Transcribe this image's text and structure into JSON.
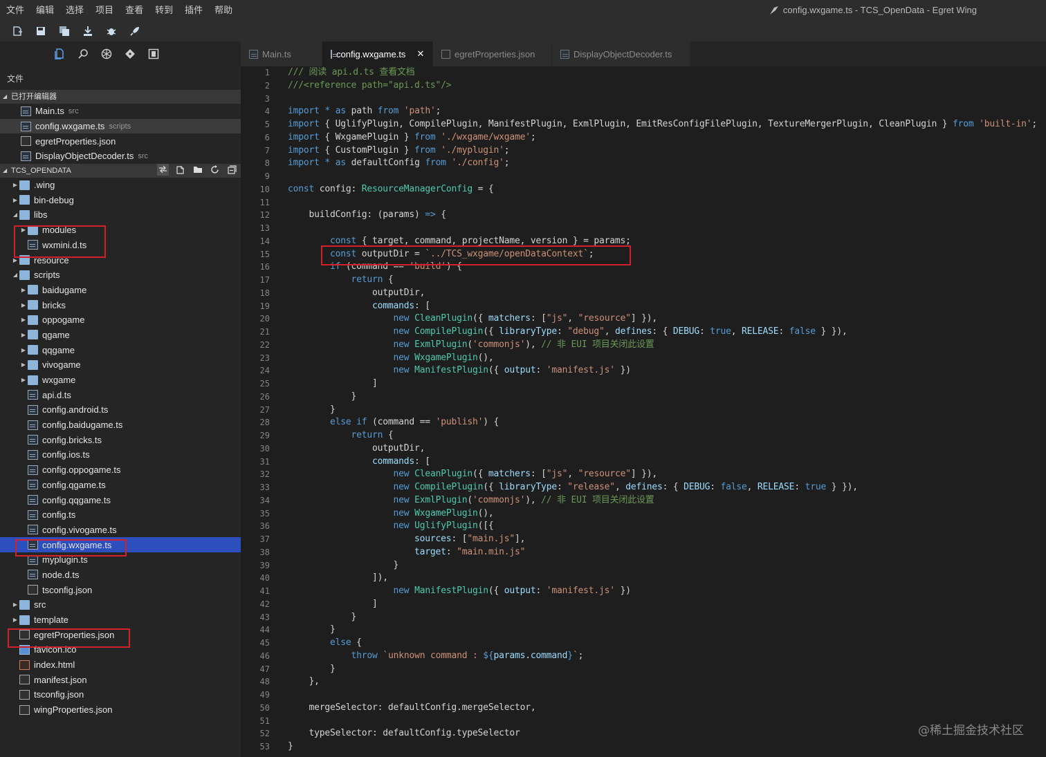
{
  "menu": [
    "文件",
    "编辑",
    "选择",
    "项目",
    "查看",
    "转到",
    "插件",
    "帮助"
  ],
  "window_title": "config.wxgame.ts - TCS_OpenData - Egret Wing",
  "sidebar": {
    "title": "文件",
    "open_editors_label": "已打开编辑器",
    "open_editors": [
      {
        "name": "Main.ts",
        "hint": "src"
      },
      {
        "name": "config.wxgame.ts",
        "hint": "scripts"
      },
      {
        "name": "egretProperties.json",
        "hint": ""
      },
      {
        "name": "DisplayObjectDecoder.ts",
        "hint": "src"
      }
    ],
    "project_label": "TCS_OPENDATA",
    "tree": [
      {
        "name": ".wing",
        "kind": "folder",
        "depth": 0,
        "open": false
      },
      {
        "name": "bin-debug",
        "kind": "folder",
        "depth": 0,
        "open": false
      },
      {
        "name": "libs",
        "kind": "folder",
        "depth": 0,
        "open": true
      },
      {
        "name": "modules",
        "kind": "folder",
        "depth": 1,
        "open": false
      },
      {
        "name": "wxmini.d.ts",
        "kind": "ts",
        "depth": 1
      },
      {
        "name": "resource",
        "kind": "folder",
        "depth": 0,
        "open": false
      },
      {
        "name": "scripts",
        "kind": "folder",
        "depth": 0,
        "open": true
      },
      {
        "name": "baidugame",
        "kind": "folder",
        "depth": 1,
        "open": false
      },
      {
        "name": "bricks",
        "kind": "folder",
        "depth": 1,
        "open": false
      },
      {
        "name": "oppogame",
        "kind": "folder",
        "depth": 1,
        "open": false
      },
      {
        "name": "qgame",
        "kind": "folder",
        "depth": 1,
        "open": false
      },
      {
        "name": "qqgame",
        "kind": "folder",
        "depth": 1,
        "open": false
      },
      {
        "name": "vivogame",
        "kind": "folder",
        "depth": 1,
        "open": false
      },
      {
        "name": "wxgame",
        "kind": "folder",
        "depth": 1,
        "open": false
      },
      {
        "name": "api.d.ts",
        "kind": "ts",
        "depth": 1
      },
      {
        "name": "config.android.ts",
        "kind": "ts",
        "depth": 1
      },
      {
        "name": "config.baidugame.ts",
        "kind": "ts",
        "depth": 1
      },
      {
        "name": "config.bricks.ts",
        "kind": "ts",
        "depth": 1
      },
      {
        "name": "config.ios.ts",
        "kind": "ts",
        "depth": 1
      },
      {
        "name": "config.oppogame.ts",
        "kind": "ts",
        "depth": 1
      },
      {
        "name": "config.qgame.ts",
        "kind": "ts",
        "depth": 1
      },
      {
        "name": "config.qqgame.ts",
        "kind": "ts",
        "depth": 1
      },
      {
        "name": "config.ts",
        "kind": "ts",
        "depth": 1
      },
      {
        "name": "config.vivogame.ts",
        "kind": "ts",
        "depth": 1
      },
      {
        "name": "config.wxgame.ts",
        "kind": "ts",
        "depth": 1,
        "selected": true
      },
      {
        "name": "myplugin.ts",
        "kind": "ts",
        "depth": 1
      },
      {
        "name": "node.d.ts",
        "kind": "ts",
        "depth": 1
      },
      {
        "name": "tsconfig.json",
        "kind": "json",
        "depth": 1
      },
      {
        "name": "src",
        "kind": "folder",
        "depth": 0,
        "open": false
      },
      {
        "name": "template",
        "kind": "folder",
        "depth": 0,
        "open": false
      },
      {
        "name": "egretProperties.json",
        "kind": "json",
        "depth": 0
      },
      {
        "name": "favicon.ico",
        "kind": "ico",
        "depth": 0
      },
      {
        "name": "index.html",
        "kind": "html",
        "depth": 0
      },
      {
        "name": "manifest.json",
        "kind": "json",
        "depth": 0
      },
      {
        "name": "tsconfig.json",
        "kind": "json",
        "depth": 0
      },
      {
        "name": "wingProperties.json",
        "kind": "json",
        "depth": 0
      }
    ]
  },
  "tabs": [
    {
      "label": "Main.ts",
      "active": false,
      "kind": "ts"
    },
    {
      "label": "config.wxgame.ts",
      "active": true,
      "kind": "ts"
    },
    {
      "label": "egretProperties.json",
      "active": false,
      "kind": "json"
    },
    {
      "label": "DisplayObjectDecoder.ts",
      "active": false,
      "kind": "ts"
    }
  ],
  "code_lines": [
    [
      [
        "c",
        "/// 阅读 api.d.ts 查看文档"
      ]
    ],
    [
      [
        "c",
        "///<reference path=\"api.d.ts\"/>"
      ]
    ],
    [],
    [
      [
        "k",
        "import"
      ],
      [
        "n",
        " "
      ],
      [
        "k",
        "*"
      ],
      [
        "n",
        " "
      ],
      [
        "k",
        "as"
      ],
      [
        "n",
        " path "
      ],
      [
        "k",
        "from"
      ],
      [
        "n",
        " "
      ],
      [
        "s",
        "'path'"
      ],
      [
        "n",
        ";"
      ]
    ],
    [
      [
        "k",
        "import"
      ],
      [
        "n",
        " { UglifyPlugin, CompilePlugin, ManifestPlugin, ExmlPlugin, EmitResConfigFilePlugin, TextureMergerPlugin, CleanPlugin } "
      ],
      [
        "k",
        "from"
      ],
      [
        "n",
        " "
      ],
      [
        "s",
        "'built-in'"
      ],
      [
        "n",
        ";"
      ]
    ],
    [
      [
        "k",
        "import"
      ],
      [
        "n",
        " { WxgamePlugin } "
      ],
      [
        "k",
        "from"
      ],
      [
        "n",
        " "
      ],
      [
        "s",
        "'./wxgame/wxgame'"
      ],
      [
        "n",
        ";"
      ]
    ],
    [
      [
        "k",
        "import"
      ],
      [
        "n",
        " { CustomPlugin } "
      ],
      [
        "k",
        "from"
      ],
      [
        "n",
        " "
      ],
      [
        "s",
        "'./myplugin'"
      ],
      [
        "n",
        ";"
      ]
    ],
    [
      [
        "k",
        "import"
      ],
      [
        "n",
        " "
      ],
      [
        "k",
        "*"
      ],
      [
        "n",
        " "
      ],
      [
        "k",
        "as"
      ],
      [
        "n",
        " defaultConfig "
      ],
      [
        "k",
        "from"
      ],
      [
        "n",
        " "
      ],
      [
        "s",
        "'./config'"
      ],
      [
        "n",
        ";"
      ]
    ],
    [],
    [
      [
        "k",
        "const"
      ],
      [
        "n",
        " config"
      ],
      [
        "n",
        ": "
      ],
      [
        "t",
        "ResourceManagerConfig"
      ],
      [
        "n",
        " = {"
      ]
    ],
    [],
    [
      [
        "n",
        "    buildConfig"
      ],
      [
        "n",
        ": (params) "
      ],
      [
        "k",
        "=>"
      ],
      [
        "n",
        " {"
      ]
    ],
    [],
    [
      [
        "n",
        "        "
      ],
      [
        "k",
        "const"
      ],
      [
        "n",
        " { target, command, projectName, version } = params;"
      ]
    ],
    [
      [
        "n",
        "        "
      ],
      [
        "k",
        "const"
      ],
      [
        "n",
        " outputDir = "
      ],
      [
        "s",
        "`../TCS_wxgame/openDataContext`"
      ],
      [
        "n",
        ";"
      ]
    ],
    [
      [
        "n",
        "        "
      ],
      [
        "k",
        "if"
      ],
      [
        "n",
        " (command == "
      ],
      [
        "s",
        "'build'"
      ],
      [
        "n",
        ") {"
      ]
    ],
    [
      [
        "n",
        "            "
      ],
      [
        "k",
        "return"
      ],
      [
        "n",
        " {"
      ]
    ],
    [
      [
        "n",
        "                outputDir,"
      ]
    ],
    [
      [
        "n",
        "                "
      ],
      [
        "p",
        "commands"
      ],
      [
        "n",
        ": ["
      ]
    ],
    [
      [
        "n",
        "                    "
      ],
      [
        "k",
        "new"
      ],
      [
        "n",
        " "
      ],
      [
        "t",
        "CleanPlugin"
      ],
      [
        "n",
        "({ "
      ],
      [
        "p",
        "matchers"
      ],
      [
        "n",
        ": ["
      ],
      [
        "s",
        "\"js\""
      ],
      [
        "n",
        ", "
      ],
      [
        "s",
        "\"resource\""
      ],
      [
        "n",
        "] }),"
      ]
    ],
    [
      [
        "n",
        "                    "
      ],
      [
        "k",
        "new"
      ],
      [
        "n",
        " "
      ],
      [
        "t",
        "CompilePlugin"
      ],
      [
        "n",
        "({ "
      ],
      [
        "p",
        "libraryType"
      ],
      [
        "n",
        ": "
      ],
      [
        "s",
        "\"debug\""
      ],
      [
        "n",
        ", "
      ],
      [
        "p",
        "defines"
      ],
      [
        "n",
        ": { "
      ],
      [
        "p",
        "DEBUG"
      ],
      [
        "n",
        ": "
      ],
      [
        "k",
        "true"
      ],
      [
        "n",
        ", "
      ],
      [
        "p",
        "RELEASE"
      ],
      [
        "n",
        ": "
      ],
      [
        "k",
        "false"
      ],
      [
        "n",
        " } }),"
      ]
    ],
    [
      [
        "n",
        "                    "
      ],
      [
        "k",
        "new"
      ],
      [
        "n",
        " "
      ],
      [
        "t",
        "ExmlPlugin"
      ],
      [
        "n",
        "("
      ],
      [
        "s",
        "'commonjs'"
      ],
      [
        "n",
        "), "
      ],
      [
        "c",
        "// 非 EUI 项目关闭此设置"
      ]
    ],
    [
      [
        "n",
        "                    "
      ],
      [
        "k",
        "new"
      ],
      [
        "n",
        " "
      ],
      [
        "t",
        "WxgamePlugin"
      ],
      [
        "n",
        "(),"
      ]
    ],
    [
      [
        "n",
        "                    "
      ],
      [
        "k",
        "new"
      ],
      [
        "n",
        " "
      ],
      [
        "t",
        "ManifestPlugin"
      ],
      [
        "n",
        "({ "
      ],
      [
        "p",
        "output"
      ],
      [
        "n",
        ": "
      ],
      [
        "s",
        "'manifest.js'"
      ],
      [
        "n",
        " })"
      ]
    ],
    [
      [
        "n",
        "                ]"
      ]
    ],
    [
      [
        "n",
        "            }"
      ]
    ],
    [
      [
        "n",
        "        }"
      ]
    ],
    [
      [
        "n",
        "        "
      ],
      [
        "k",
        "else if"
      ],
      [
        "n",
        " (command == "
      ],
      [
        "s",
        "'publish'"
      ],
      [
        "n",
        ") {"
      ]
    ],
    [
      [
        "n",
        "            "
      ],
      [
        "k",
        "return"
      ],
      [
        "n",
        " {"
      ]
    ],
    [
      [
        "n",
        "                outputDir,"
      ]
    ],
    [
      [
        "n",
        "                "
      ],
      [
        "p",
        "commands"
      ],
      [
        "n",
        ": ["
      ]
    ],
    [
      [
        "n",
        "                    "
      ],
      [
        "k",
        "new"
      ],
      [
        "n",
        " "
      ],
      [
        "t",
        "CleanPlugin"
      ],
      [
        "n",
        "({ "
      ],
      [
        "p",
        "matchers"
      ],
      [
        "n",
        ": ["
      ],
      [
        "s",
        "\"js\""
      ],
      [
        "n",
        ", "
      ],
      [
        "s",
        "\"resource\""
      ],
      [
        "n",
        "] }),"
      ]
    ],
    [
      [
        "n",
        "                    "
      ],
      [
        "k",
        "new"
      ],
      [
        "n",
        " "
      ],
      [
        "t",
        "CompilePlugin"
      ],
      [
        "n",
        "({ "
      ],
      [
        "p",
        "libraryType"
      ],
      [
        "n",
        ": "
      ],
      [
        "s",
        "\"release\""
      ],
      [
        "n",
        ", "
      ],
      [
        "p",
        "defines"
      ],
      [
        "n",
        ": { "
      ],
      [
        "p",
        "DEBUG"
      ],
      [
        "n",
        ": "
      ],
      [
        "k",
        "false"
      ],
      [
        "n",
        ", "
      ],
      [
        "p",
        "RELEASE"
      ],
      [
        "n",
        ": "
      ],
      [
        "k",
        "true"
      ],
      [
        "n",
        " } }),"
      ]
    ],
    [
      [
        "n",
        "                    "
      ],
      [
        "k",
        "new"
      ],
      [
        "n",
        " "
      ],
      [
        "t",
        "ExmlPlugin"
      ],
      [
        "n",
        "("
      ],
      [
        "s",
        "'commonjs'"
      ],
      [
        "n",
        "), "
      ],
      [
        "c",
        "// 非 EUI 项目关闭此设置"
      ]
    ],
    [
      [
        "n",
        "                    "
      ],
      [
        "k",
        "new"
      ],
      [
        "n",
        " "
      ],
      [
        "t",
        "WxgamePlugin"
      ],
      [
        "n",
        "(),"
      ]
    ],
    [
      [
        "n",
        "                    "
      ],
      [
        "k",
        "new"
      ],
      [
        "n",
        " "
      ],
      [
        "t",
        "UglifyPlugin"
      ],
      [
        "n",
        "([{"
      ]
    ],
    [
      [
        "n",
        "                        "
      ],
      [
        "p",
        "sources"
      ],
      [
        "n",
        ": ["
      ],
      [
        "s",
        "\"main.js\""
      ],
      [
        "n",
        "],"
      ]
    ],
    [
      [
        "n",
        "                        "
      ],
      [
        "p",
        "target"
      ],
      [
        "n",
        ": "
      ],
      [
        "s",
        "\"main.min.js\""
      ]
    ],
    [
      [
        "n",
        "                    }"
      ]
    ],
    [
      [
        "n",
        "                ]),"
      ]
    ],
    [
      [
        "n",
        "                    "
      ],
      [
        "k",
        "new"
      ],
      [
        "n",
        " "
      ],
      [
        "t",
        "ManifestPlugin"
      ],
      [
        "n",
        "({ "
      ],
      [
        "p",
        "output"
      ],
      [
        "n",
        ": "
      ],
      [
        "s",
        "'manifest.js'"
      ],
      [
        "n",
        " })"
      ]
    ],
    [
      [
        "n",
        "                ]"
      ]
    ],
    [
      [
        "n",
        "            }"
      ]
    ],
    [
      [
        "n",
        "        }"
      ]
    ],
    [
      [
        "n",
        "        "
      ],
      [
        "k",
        "else"
      ],
      [
        "n",
        " {"
      ]
    ],
    [
      [
        "n",
        "            "
      ],
      [
        "k",
        "throw"
      ],
      [
        "n",
        " "
      ],
      [
        "s",
        "`unknown command : "
      ],
      [
        "k",
        "${"
      ],
      [
        "p",
        "params"
      ],
      [
        "n",
        "."
      ],
      [
        "p",
        "command"
      ],
      [
        "k",
        "}"
      ],
      [
        "s",
        "`"
      ],
      [
        "n",
        ";"
      ]
    ],
    [
      [
        "n",
        "        }"
      ]
    ],
    [
      [
        "n",
        "    },"
      ]
    ],
    [],
    [
      [
        "n",
        "    mergeSelector: defaultConfig.mergeSelector,"
      ]
    ],
    [],
    [
      [
        "n",
        "    typeSelector: defaultConfig.typeSelector"
      ]
    ],
    [
      [
        "n",
        "}"
      ]
    ]
  ],
  "watermark": "@稀土掘金技术社区"
}
